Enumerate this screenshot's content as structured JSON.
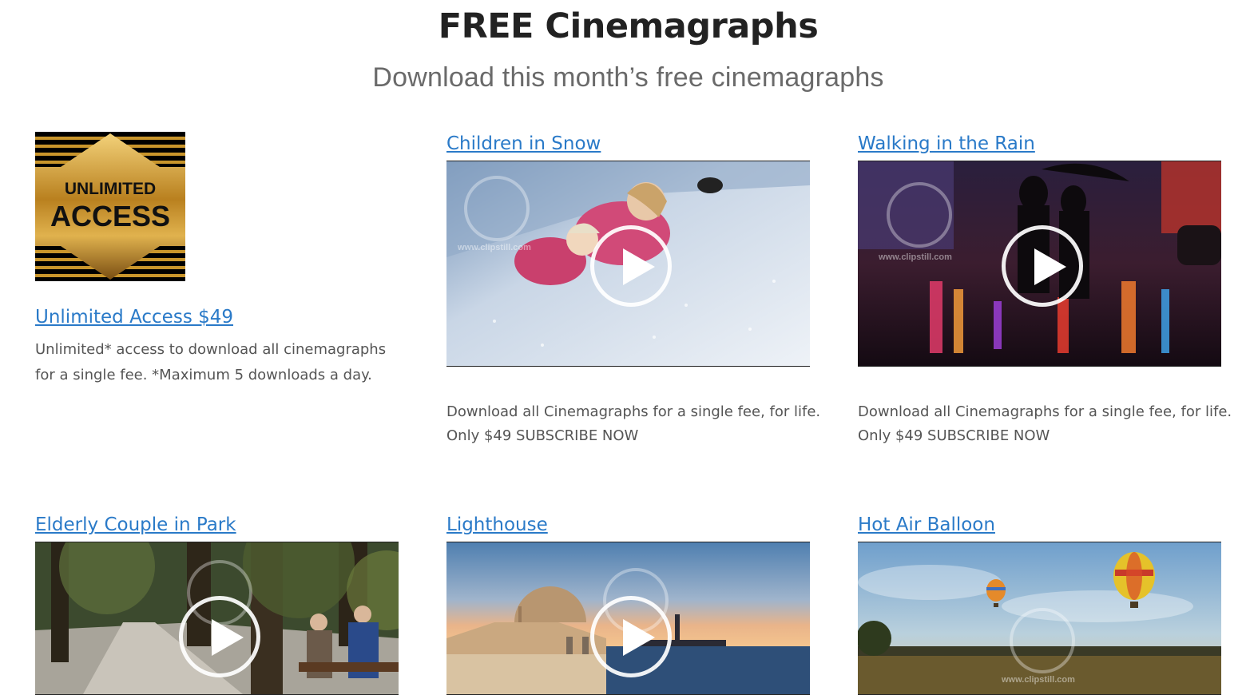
{
  "header": {
    "title": "FREE Cinemagraphs",
    "subtitle": "Download this month’s free cinemagraphs"
  },
  "promo": {
    "badge_line1": "UNLIMITED",
    "badge_line2": "ACCESS",
    "link": "Unlimited Access $49",
    "desc_line1": "Unlimited* access to download all cinemagraphs",
    "desc_line2": "for a single fee. *Maximum 5 downloads a day."
  },
  "watermark": "www.clipstill.com",
  "cards": [
    {
      "title": "Children in Snow",
      "desc_line1": "Download all Cinemagraphs for a single fee, for life.",
      "desc_line2": "Only $49 SUBSCRIBE NOW"
    },
    {
      "title": "Walking in the Rain",
      "desc_line1": "Download all Cinemagraphs for a single fee, for life.",
      "desc_line2": "Only $49 SUBSCRIBE NOW"
    },
    {
      "title": "Elderly Couple in Park"
    },
    {
      "title": "Lighthouse"
    },
    {
      "title": "Hot Air Balloon"
    }
  ],
  "colors": {
    "link": "#2a7ac8",
    "heading": "#222222",
    "text": "#555555",
    "badge_gold": "#c9952b"
  },
  "icons": [
    "play-icon",
    "watermark-logo-icon"
  ]
}
